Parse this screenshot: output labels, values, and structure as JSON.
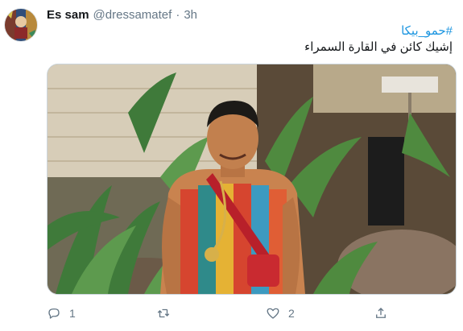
{
  "tweet": {
    "author_name": "Es sam",
    "handle": "@dressamatef",
    "separator": "·",
    "time": "3h",
    "hashtag": "#حمو_بيكا",
    "text": "إشيك كائن في القارة السمراء",
    "avatar_alt": "avatar"
  },
  "actions": {
    "reply_count": "1",
    "retweet_count": "",
    "like_count": "2"
  },
  "icons": {
    "reply": "reply-icon",
    "retweet": "retweet-icon",
    "like": "heart-icon",
    "share": "share-icon"
  },
  "colors": {
    "link": "#1b95e0",
    "muted": "#657786"
  }
}
